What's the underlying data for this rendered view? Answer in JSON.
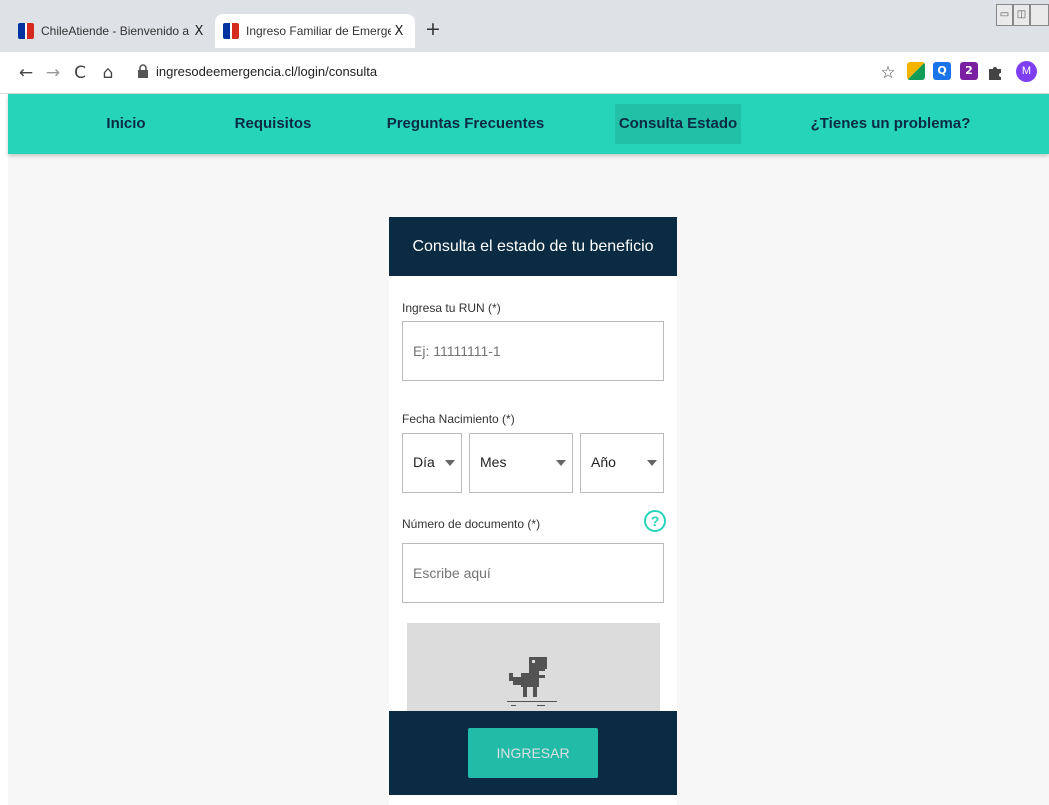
{
  "browser": {
    "tabs": [
      {
        "title": "ChileAtiende - Bienvenido a Chile",
        "close": "X"
      },
      {
        "title": "Ingreso Familiar de Emergencia -",
        "close": "X"
      }
    ],
    "new_tab": "+",
    "url": "ingresodeemergencia.cl/login/consulta",
    "nav_icons": {
      "back": "←",
      "forward": "→",
      "reload": "C",
      "home": "⌂"
    },
    "bookmark_star": "☆",
    "extensions": [
      {
        "name": "ext-colorful-icon",
        "glyph": "",
        "color": "#f4b400"
      },
      {
        "name": "ext-q-icon",
        "glyph": "Q",
        "color": "#1a73e8"
      },
      {
        "name": "ext-2-icon",
        "glyph": "2",
        "color": "#7b1fa2"
      },
      {
        "name": "puzzle-icon",
        "glyph": "",
        "color": "#444444"
      }
    ],
    "avatar_letter": "M"
  },
  "site_nav": {
    "items": [
      "Inicio",
      "Requisitos",
      "Preguntas Frecuentes",
      "Consulta Estado",
      "¿Tienes un problema?"
    ],
    "active_index": 3
  },
  "form": {
    "title": "Consulta el estado de tu beneficio",
    "run_label": "Ingresa tu RUN (*)",
    "run_placeholder": "Ej: 11111111-1",
    "birth_label": "Fecha Nacimiento (*)",
    "day": "Día",
    "month": "Mes",
    "year": "Año",
    "doc_label": "Número de documento (*)",
    "help_glyph": "?",
    "doc_placeholder": "Escribe aquí",
    "submit": "INGRESAR"
  },
  "colors": {
    "accent": "#26d5b9",
    "dark": "#0b2b43"
  }
}
